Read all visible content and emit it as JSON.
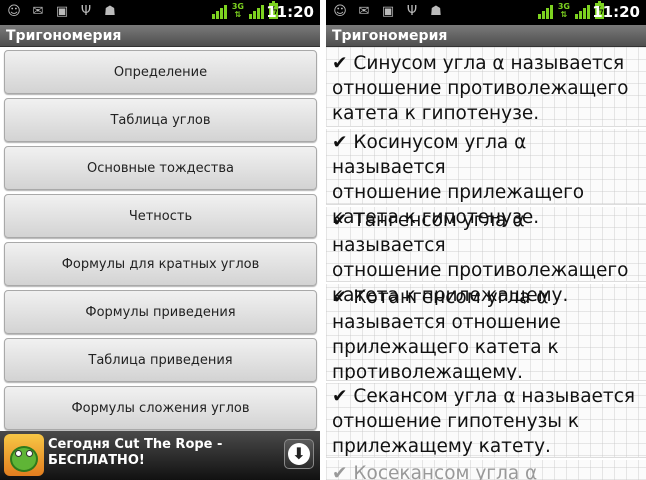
{
  "colors": {
    "signal": "#7dd320",
    "title_bar": "#5f5f5f"
  },
  "left_screen": {
    "status_bar": {
      "left_icons": [
        "smiley-icon",
        "mail-icon",
        "lock-icon",
        "usb-icon",
        "android-icon"
      ],
      "network_label": "3G",
      "time": "11:20"
    },
    "title": "Тригономерия",
    "menu": [
      "Определение",
      "Таблица углов",
      "Основные тождества",
      "Четность",
      "Формулы для кратных углов",
      "Формулы приведения",
      "Таблица приведения",
      "Формулы сложения углов"
    ],
    "ad": {
      "line1": "Сегодня Cut The Rope -",
      "line2": "БЕСПЛАТНО!"
    }
  },
  "right_screen": {
    "status_bar": {
      "left_icons": [
        "smiley-icon",
        "mail-icon",
        "lock-icon",
        "usb-icon",
        "android-icon"
      ],
      "network_label": "3G",
      "time": "11:20"
    },
    "title": "Тригономерия",
    "check_mark": "✔",
    "definitions": [
      {
        "line1": "Синусом угла α называется",
        "line2": "отношение противолежащего",
        "line3": "катета к гипотенузе."
      },
      {
        "line1": "Косинусом угла α называется",
        "line2": "отношение прилежащего",
        "line3": "катета к гипотенузе."
      },
      {
        "line1": "Тангенсом угла α называется",
        "line2": "отношение противолежащего",
        "line3": "катета к прилежащему."
      },
      {
        "line1": "Котангенсом угла α",
        "line2": "называется отношение",
        "line3": "прилежащего катета к",
        "line4": "противолежащему."
      },
      {
        "line1": "Секансом угла α называется",
        "line2": "отношение гипотенузы к",
        "line3": "прилежащему катету."
      },
      {
        "line1": "Косекансом угла α"
      }
    ]
  }
}
